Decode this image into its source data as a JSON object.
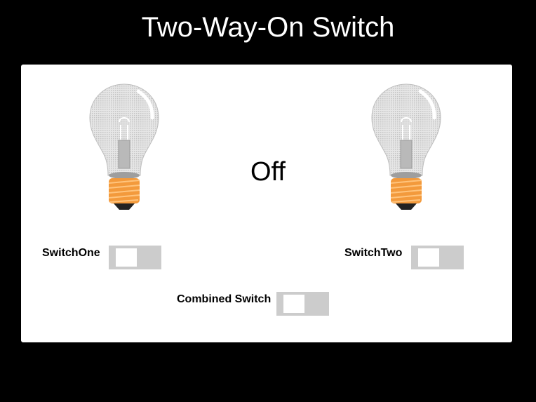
{
  "header": {
    "title": "Two-Way-On Switch"
  },
  "status": {
    "text": "Off"
  },
  "switches": {
    "one": {
      "label": "SwitchOne",
      "on": false
    },
    "two": {
      "label": "SwitchTwo",
      "on": false
    },
    "combined": {
      "label": "Combined Switch",
      "on": false
    }
  },
  "icons": {
    "bulb_left": "lightbulb-off-icon",
    "bulb_right": "lightbulb-off-icon"
  },
  "colors": {
    "background": "#000000",
    "panel": "#ffffff",
    "toggle_track": "#cccccc",
    "toggle_knob": "#ffffff",
    "bulb_base": "#f39a3c"
  }
}
